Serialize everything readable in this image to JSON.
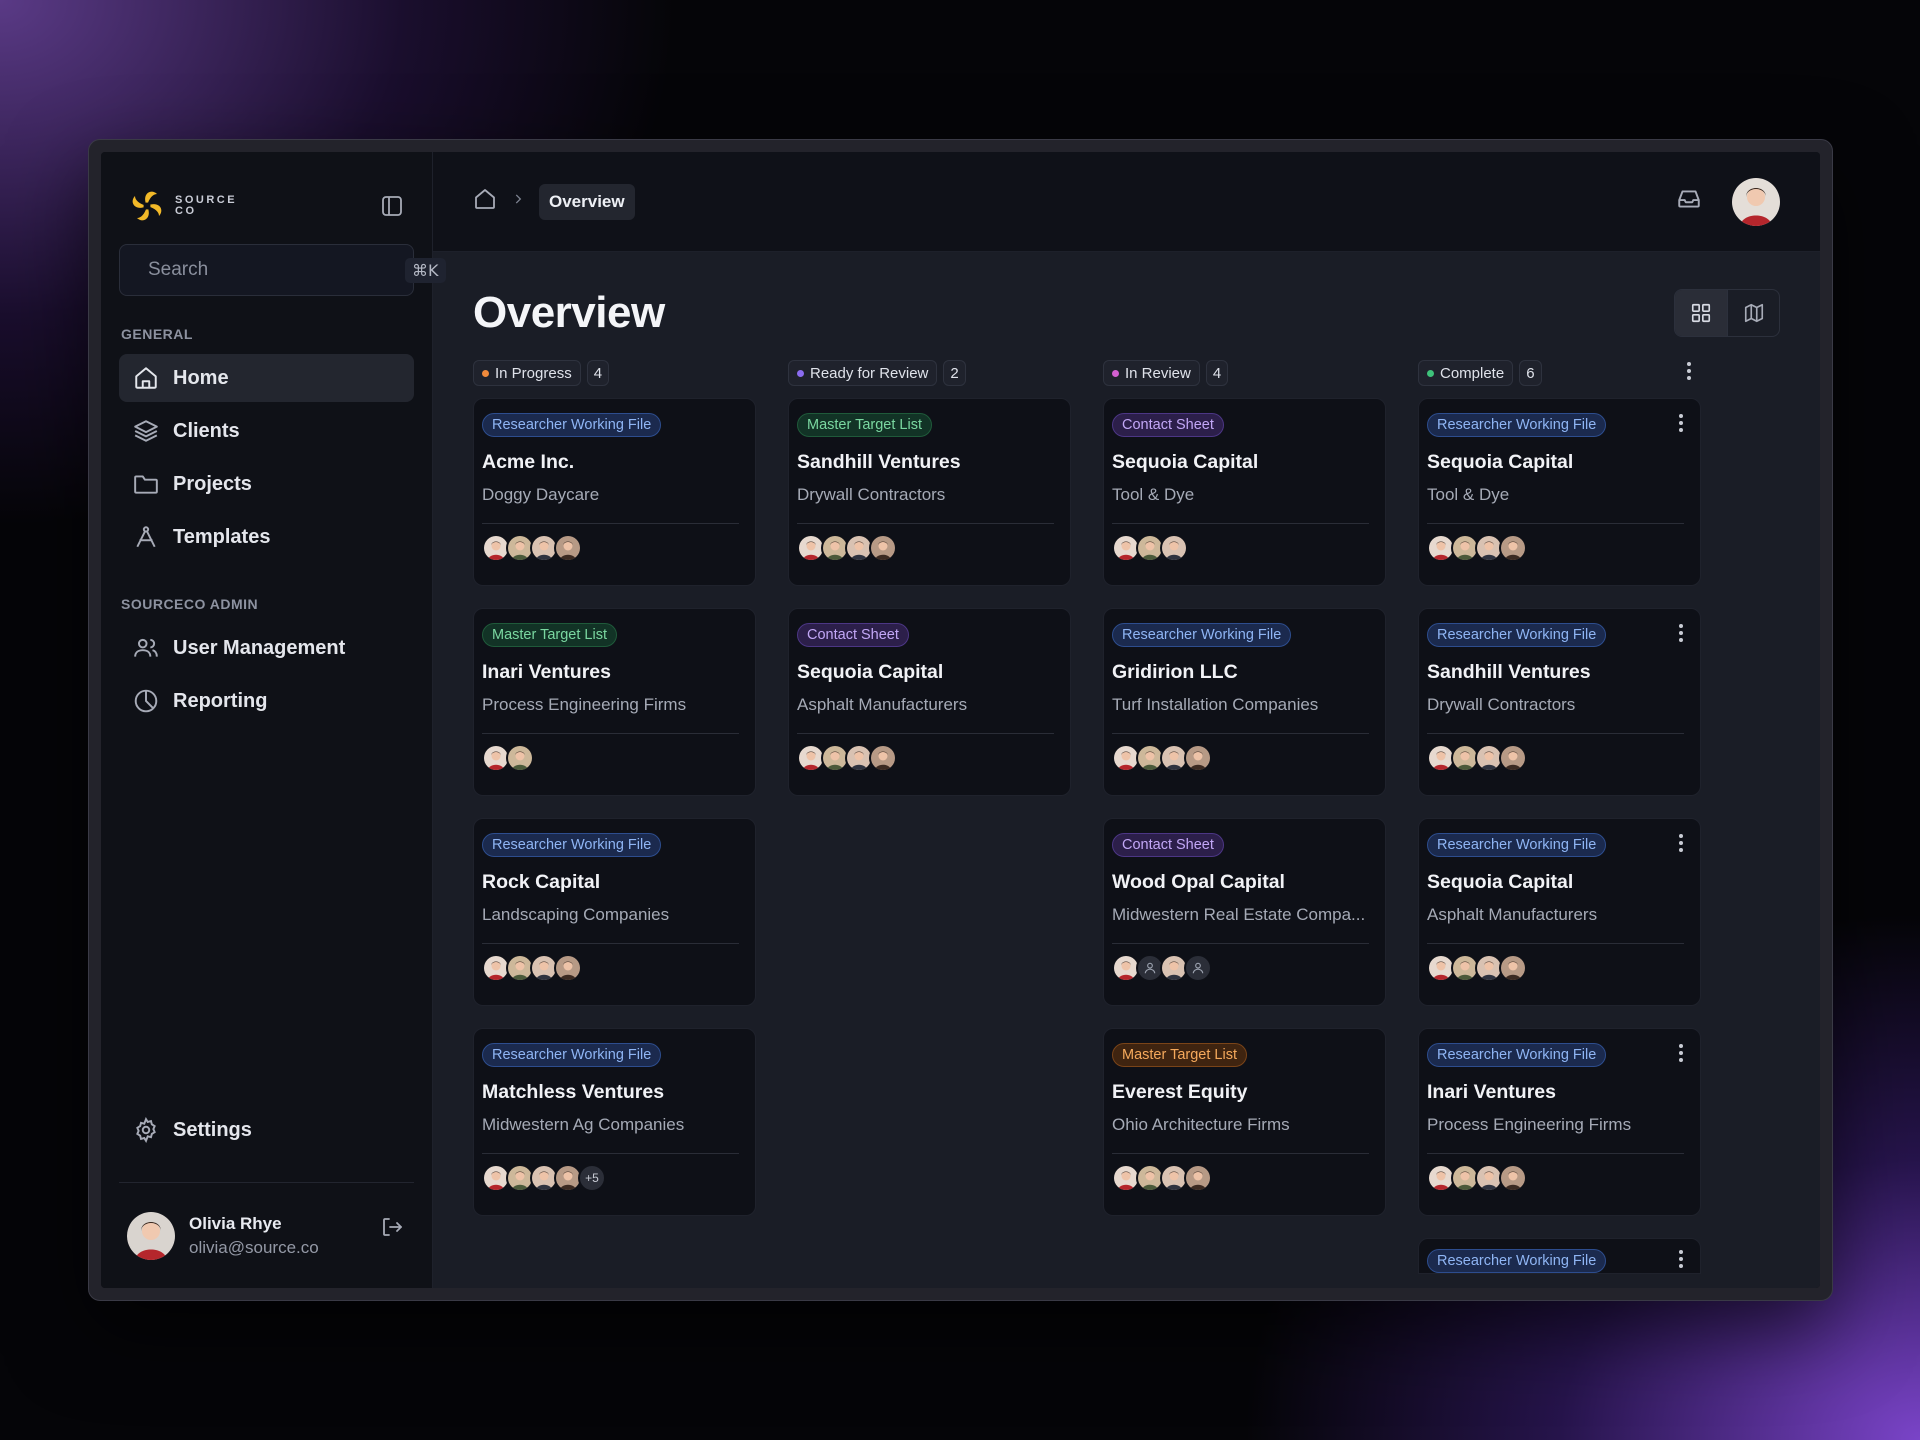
{
  "brand": {
    "line1": "SOURCE",
    "line2": "CO"
  },
  "search": {
    "placeholder": "Search",
    "shortcut": "⌘K"
  },
  "sidebar": {
    "general_label": "GENERAL",
    "general_items": [
      {
        "label": "Home",
        "icon": "home-icon",
        "active": true
      },
      {
        "label": "Clients",
        "icon": "layers-icon"
      },
      {
        "label": "Projects",
        "icon": "folder-icon"
      },
      {
        "label": "Templates",
        "icon": "compass-icon"
      }
    ],
    "admin_label": "SOURCECO ADMIN",
    "admin_items": [
      {
        "label": "User Management",
        "icon": "users-icon"
      },
      {
        "label": "Reporting",
        "icon": "pie-chart-icon"
      }
    ],
    "settings_label": "Settings"
  },
  "user": {
    "name": "Olivia Rhye",
    "email": "olivia@source.co"
  },
  "breadcrumb": {
    "current": "Overview"
  },
  "page": {
    "title": "Overview"
  },
  "colors": {
    "in_progress": "#f08a3c",
    "ready": "#8b6cf0",
    "in_review": "#d35fd0",
    "complete": "#3ec27a"
  },
  "columns": [
    {
      "status": "In Progress",
      "count": "4",
      "dot": "#f08a3c",
      "cards": [
        {
          "tag": "Researcher Working File",
          "tag_style": "blue",
          "title": "Acme Inc.",
          "sub": "Doggy Daycare",
          "avatars": 4
        },
        {
          "tag": "Master Target List",
          "tag_style": "green",
          "title": "Inari Ventures",
          "sub": "Process Engineering Firms",
          "avatars": 2
        },
        {
          "tag": "Researcher Working File",
          "tag_style": "blue",
          "title": "Rock Capital",
          "sub": "Landscaping Companies",
          "avatars": 4
        },
        {
          "tag": "Researcher Working File",
          "tag_style": "blue",
          "title": "Matchless Ventures",
          "sub": "Midwestern Ag Companies",
          "avatars": 4,
          "more": "+5"
        }
      ]
    },
    {
      "status": "Ready for Review",
      "count": "2",
      "dot": "#8b6cf0",
      "cards": [
        {
          "tag": "Master Target List",
          "tag_style": "green",
          "title": "Sandhill Ventures",
          "sub": "Drywall Contractors",
          "avatars": 4
        },
        {
          "tag": "Contact Sheet",
          "tag_style": "purple",
          "title": "Sequoia Capital",
          "sub": "Asphalt Manufacturers",
          "avatars": 4
        }
      ]
    },
    {
      "status": "In Review",
      "count": "4",
      "dot": "#d35fd0",
      "cards": [
        {
          "tag": "Contact Sheet",
          "tag_style": "purple",
          "title": "Sequoia Capital",
          "sub": "Tool & Dye",
          "avatars": 3
        },
        {
          "tag": "Researcher Working File",
          "tag_style": "blue",
          "title": "Gridirion LLC",
          "sub": "Turf Installation Companies",
          "avatars": 4
        },
        {
          "tag": "Contact Sheet",
          "tag_style": "purple",
          "title": "Wood Opal Capital",
          "sub": "Midwestern Real Estate Compa...",
          "avatars": 4,
          "placeholders": [
            1,
            3
          ]
        },
        {
          "tag": "Master Target List",
          "tag_style": "orange",
          "title": "Everest Equity",
          "sub": "Ohio Architecture Firms",
          "avatars": 4
        }
      ]
    },
    {
      "status": "Complete",
      "count": "6",
      "dot": "#3ec27a",
      "menu": true,
      "cards": [
        {
          "tag": "Researcher Working File",
          "tag_style": "blue",
          "title": "Sequoia Capital",
          "sub": "Tool & Dye",
          "avatars": 4,
          "menu": true
        },
        {
          "tag": "Researcher Working File",
          "tag_style": "blue",
          "title": "Sandhill Ventures",
          "sub": "Drywall Contractors",
          "avatars": 4,
          "menu": true
        },
        {
          "tag": "Researcher Working File",
          "tag_style": "blue",
          "title": "Sequoia Capital",
          "sub": "Asphalt Manufacturers",
          "avatars": 4,
          "menu": true
        },
        {
          "tag": "Researcher Working File",
          "tag_style": "blue",
          "title": "Inari Ventures",
          "sub": "Process Engineering Firms",
          "avatars": 4,
          "menu": true
        },
        {
          "tag": "Researcher Working File",
          "tag_style": "blue",
          "title": "",
          "sub": "",
          "avatars": 0,
          "menu": true
        }
      ]
    }
  ]
}
